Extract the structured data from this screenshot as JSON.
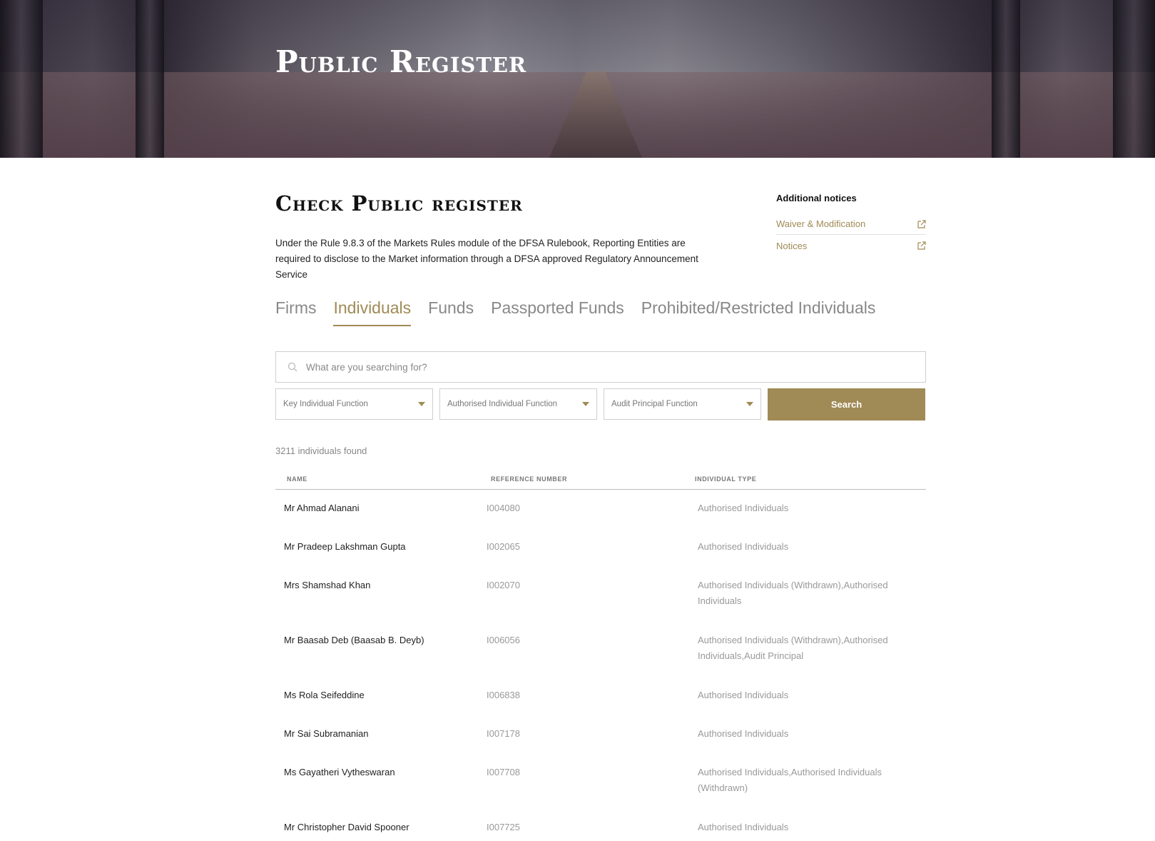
{
  "hero": {
    "title": "Public Register"
  },
  "main": {
    "title": "Check Public register",
    "intro": "Under the Rule 9.8.3 of the Markets Rules module of the DFSA Rulebook, Reporting Entities are required to disclose to the Market information through a DFSA approved Regulatory Announcement Service"
  },
  "sidebar": {
    "title": "Additional notices",
    "links": [
      {
        "label": "Waiver & Modification",
        "icon": "external-link-icon"
      },
      {
        "label": "Notices",
        "icon": "external-link-icon"
      }
    ]
  },
  "tabs": [
    {
      "label": "Firms",
      "active": false
    },
    {
      "label": "Individuals",
      "active": true
    },
    {
      "label": "Funds",
      "active": false
    },
    {
      "label": "Passported Funds",
      "active": false
    },
    {
      "label": "Prohibited/Restricted Individuals",
      "active": false
    }
  ],
  "search": {
    "placeholder": "What are you searching for?",
    "value": "",
    "filters": [
      "Key Individual Function",
      "Authorised Individual Function",
      "Audit Principal Function"
    ],
    "button_label": "Search"
  },
  "results": {
    "count_text": "3211 individuals found",
    "columns": [
      "NAME",
      "REFERENCE NUMBER",
      "INDIVIDUAL TYPE"
    ],
    "rows": [
      {
        "name": "Mr Ahmad Alanani",
        "ref": "I004080",
        "type": "Authorised Individuals"
      },
      {
        "name": "Mr Pradeep Lakshman Gupta",
        "ref": "I002065",
        "type": "Authorised Individuals"
      },
      {
        "name": "Mrs Shamshad Khan",
        "ref": "I002070",
        "type": "Authorised Individuals (Withdrawn),Authorised Individuals"
      },
      {
        "name": "Mr Baasab Deb (Baasab B. Deyb)",
        "ref": "I006056",
        "type": "Authorised Individuals (Withdrawn),Authorised Individuals,Audit Principal"
      },
      {
        "name": "Ms Rola Seifeddine",
        "ref": "I006838",
        "type": "Authorised Individuals"
      },
      {
        "name": "Mr Sai Subramanian",
        "ref": "I007178",
        "type": "Authorised Individuals"
      },
      {
        "name": "Ms Gayatheri Vytheswaran",
        "ref": "I007708",
        "type": "Authorised Individuals,Authorised Individuals (Withdrawn)"
      },
      {
        "name": "Mr Christopher David Spooner",
        "ref": "I007725",
        "type": "Authorised Individuals"
      }
    ]
  },
  "colors": {
    "accent": "#a08a55"
  }
}
